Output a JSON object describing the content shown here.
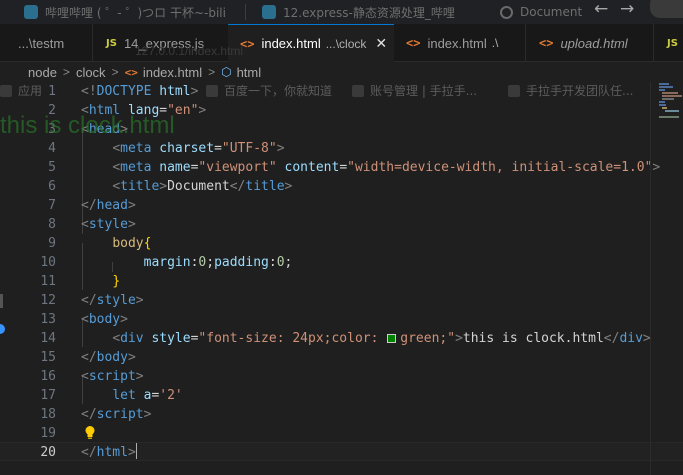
{
  "browser": {
    "tabs": [
      {
        "label": "哔哩哔哩 ( ゜- ゜)つロ 干杯~-bili",
        "icon": "bilibili-icon"
      },
      {
        "label": "12.express-静态资源处理_哔哩",
        "icon": "bilibili-icon"
      },
      {
        "label": "Document",
        "icon": "globe-icon"
      }
    ],
    "nav": {
      "back": "←",
      "forward": "→"
    },
    "address": "127.0.0.1/index.html",
    "bookmarks": [
      {
        "label": "应用"
      },
      {
        "label": "百度一下，你就知道"
      },
      {
        "label": "账号管理 | 手拉手..."
      },
      {
        "label": "手拉手开发团队任..."
      }
    ],
    "page_text": "this is clock.html"
  },
  "editor": {
    "tabs": [
      {
        "icon": "",
        "label": "...\\testm",
        "desc": ""
      },
      {
        "icon": "JS",
        "label": "14_express.js",
        "desc": ""
      },
      {
        "icon": "<>",
        "label": "index.html",
        "desc": "...\\clock",
        "close": "✕"
      },
      {
        "icon": "<>",
        "label": "index.html",
        "desc": ".\\"
      },
      {
        "icon": "<>",
        "label": "upload.html",
        "desc": ""
      },
      {
        "icon": "JS",
        "label": "",
        "desc": ""
      }
    ],
    "breadcrumb": [
      "node",
      "clock",
      "index.html",
      "html"
    ],
    "line_numbers": [
      "1",
      "2",
      "3",
      "4",
      "5",
      "6",
      "7",
      "8",
      "9",
      "10",
      "11",
      "12",
      "13",
      "14",
      "15",
      "16",
      "17",
      "18",
      "19",
      "20"
    ],
    "current_line": "20",
    "code": {
      "l1": {
        "open": "<!",
        "doctype": "DOCTYPE",
        "html": "html",
        "close": ">"
      },
      "l2": {
        "lt": "<",
        "tag": "html",
        "attr": "lang",
        "eq": "=",
        "val": "\"en\"",
        "gt": ">"
      },
      "l3": {
        "lt": "<",
        "tag": "head",
        "gt": ">"
      },
      "l4": {
        "lt": "<",
        "tag": "meta",
        "attr": "charset",
        "eq": "=",
        "val": "\"UTF-8\"",
        "gt": ">"
      },
      "l5": {
        "lt": "<",
        "tag": "meta",
        "attr1": "name",
        "eq1": "=",
        "val1": "\"viewport\"",
        "attr2": "content",
        "eq2": "=",
        "val2": "\"width=device-width, initial-scale=1.0\"",
        "gt": ">"
      },
      "l6": {
        "lt": "<",
        "tag": "title",
        "gt": ">",
        "text": "Document",
        "lt2": "</",
        "tag2": "title",
        "gt2": ">"
      },
      "l7": {
        "lt": "</",
        "tag": "head",
        "gt": ">"
      },
      "l8": {
        "lt": "<",
        "tag": "style",
        "gt": ">"
      },
      "l9": {
        "sel": "body",
        "brace": "{"
      },
      "l10": {
        "prop1": "margin",
        "colon1": ":",
        "v1": "0",
        "semi1": ";",
        "prop2": "padding",
        "colon2": ":",
        "v2": "0",
        "semi2": ";"
      },
      "l11": {
        "brace": "}"
      },
      "l12": {
        "lt": "</",
        "tag": "style",
        "gt": ">"
      },
      "l13": {
        "lt": "<",
        "tag": "body",
        "gt": ">"
      },
      "l14": {
        "lt": "<",
        "tag": "div",
        "attr": "style",
        "eq": "=",
        "q1": "\"",
        "css1": "font-size: 24px;color: ",
        "css2": "green;",
        "q2": "\"",
        "gt": ">",
        "text": "this is clock.html",
        "lt2": "</",
        "tag2": "div",
        "gt2": ">"
      },
      "l15": {
        "lt": "</",
        "tag": "body",
        "gt": ">"
      },
      "l16": {
        "lt": "<",
        "tag": "script",
        "gt": ">"
      },
      "l17": {
        "kw": "let",
        "var": "a",
        "eq": "=",
        "val": "'2'"
      },
      "l18": {
        "lt": "</",
        "tag": "script",
        "gt": ">"
      },
      "l19": {},
      "l20": {
        "lt": "</",
        "tag": "html",
        "gt": ">"
      }
    },
    "colors": {
      "background": "#1f1f1f",
      "tag": "#569cd6",
      "attribute": "#9cdcfe",
      "string": "#ce9178",
      "bracket": "#808080",
      "brace": "#ffd700",
      "number": "#b5cea8",
      "accent": "#0078d4"
    }
  }
}
